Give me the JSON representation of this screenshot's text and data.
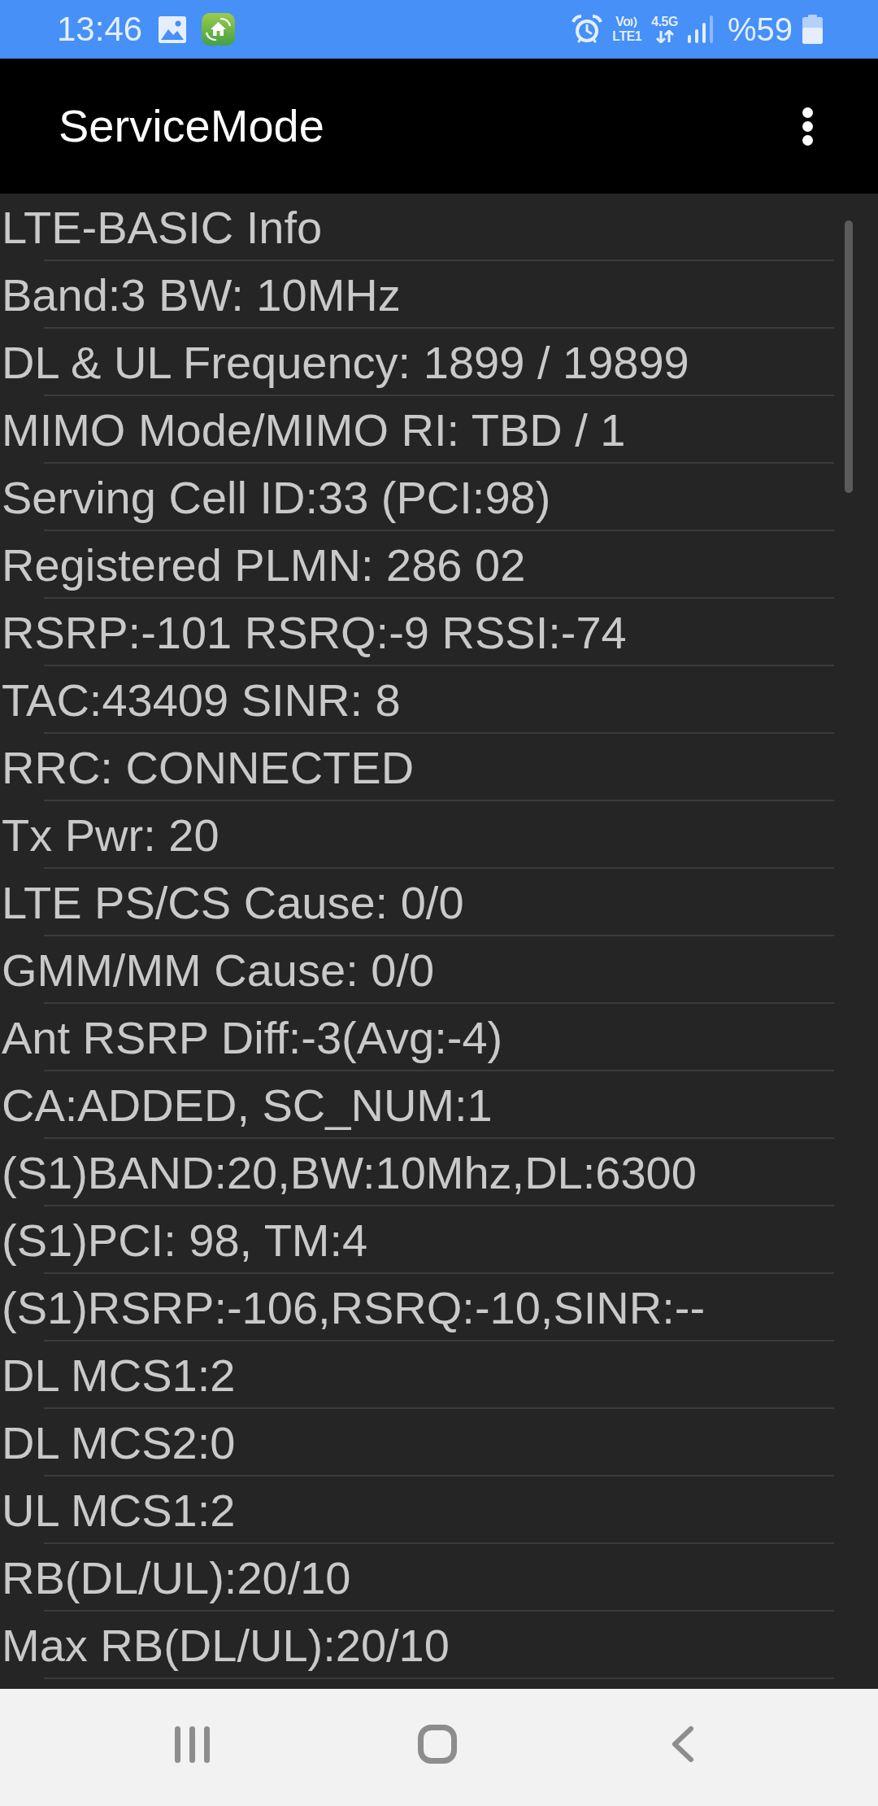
{
  "status_bar": {
    "time": "13:46",
    "volte": "Vo",
    "volte_sim": "LTE1",
    "network": "4.5G",
    "battery": "%59"
  },
  "app_bar": {
    "title": "ServiceMode"
  },
  "info_lines": [
    "LTE-BASIC Info",
    "Band:3 BW: 10MHz",
    "DL & UL Frequency: 1899 / 19899",
    "MIMO Mode/MIMO RI: TBD / 1",
    "Serving Cell ID:33 (PCI:98)",
    "Registered PLMN: 286 02",
    "RSRP:-101 RSRQ:-9 RSSI:-74",
    "TAC:43409 SINR: 8",
    "RRC: CONNECTED",
    "Tx Pwr: 20",
    "LTE PS/CS Cause: 0/0",
    "GMM/MM Cause: 0/0",
    "Ant RSRP Diff:-3(Avg:-4)",
    "CA:ADDED, SC_NUM:1",
    "(S1)BAND:20,BW:10Mhz,DL:6300",
    "(S1)PCI: 98, TM:4",
    "(S1)RSRP:-106,RSRQ:-10,SINR:--",
    "DL MCS1:2",
    "DL MCS2:0",
    "UL MCS1:2",
    "RB(DL/UL):20/10",
    "Max RB(DL/UL):20/10"
  ]
}
